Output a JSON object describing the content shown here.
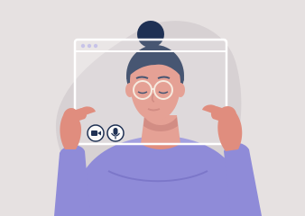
{
  "colors": {
    "background": "#e6e1e1",
    "blob": "#d7d1d3",
    "skin": "#e08d7e",
    "skin_shadow": "#c9746a",
    "hair": "#1f3154",
    "sweater": "#8f8bd8",
    "sweater_shadow": "#7c77c9",
    "frame_stroke": "#ffffff",
    "frame_fill": "rgba(255,255,255,0.18)",
    "window_dot": "#c7c3e8",
    "control_icon": "#1f3154"
  },
  "icons": {
    "camera": "video-camera-icon",
    "mic": "microphone-icon"
  }
}
